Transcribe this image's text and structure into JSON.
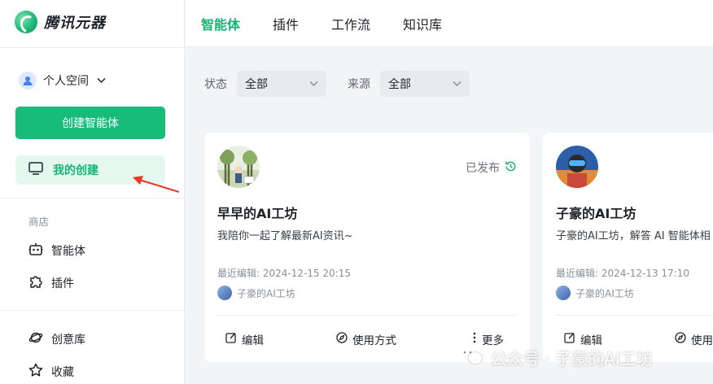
{
  "brand": {
    "name": "腾讯元器"
  },
  "topbar": {
    "tabs": [
      {
        "label": "智能体",
        "active": true
      },
      {
        "label": "插件",
        "active": false
      },
      {
        "label": "工作流",
        "active": false
      },
      {
        "label": "知识库",
        "active": false
      }
    ]
  },
  "sidebar": {
    "space_label": "个人空间",
    "create_button": "创建智能体",
    "my_create": "我的创建",
    "store_section": "商店",
    "store_items": [
      {
        "label": "智能体",
        "icon": "robot-icon"
      },
      {
        "label": "插件",
        "icon": "puzzle-icon"
      }
    ],
    "other_items": [
      {
        "label": "创意库",
        "icon": "planet-icon"
      },
      {
        "label": "收藏",
        "icon": "star-icon"
      }
    ]
  },
  "filters": {
    "status_label": "状态",
    "status_value": "全部",
    "source_label": "来源",
    "source_value": "全部"
  },
  "cards": [
    {
      "title": "早早的AI工坊",
      "description": "我陪你一起了解最新AI资讯~",
      "status": "已发布",
      "last_edit": "最近编辑: 2024-12-15 20:15",
      "author": "子豪的AI工坊",
      "actions": {
        "edit": "编辑",
        "usage": "使用方式",
        "more": "更多"
      }
    },
    {
      "title": "子豪的AI工坊",
      "description": "子豪的AI工坊，解答 AI 智能体相",
      "last_edit": "最近编辑: 2024-12-13 17:10",
      "author": "子豪的AI工坊",
      "actions": {
        "edit": "编辑",
        "usage": "使用"
      }
    }
  ],
  "watermark": {
    "text": "公众号 · 子豪的AI工坊"
  },
  "colors": {
    "accent": "#17bb7a",
    "accent_light": "#e4f8ef",
    "annotation_arrow": "#e8392b"
  }
}
